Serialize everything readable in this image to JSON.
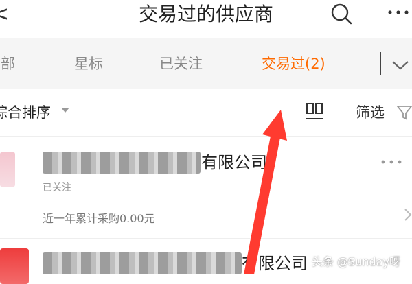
{
  "header": {
    "title": "交易过的供应商",
    "back_glyph": "<",
    "icons": {
      "back": "chevron-left-icon",
      "search": "search-icon",
      "more": "more-icon"
    }
  },
  "tabs": [
    {
      "label": "全部"
    },
    {
      "label": "星标"
    },
    {
      "label": "已关注"
    },
    {
      "label": "交易过(2)",
      "active": true
    }
  ],
  "toolbar": {
    "sort_label": "综合排序",
    "filter_label": "筛选"
  },
  "list": {
    "items": [
      {
        "name_suffix": "有限公司",
        "tag": "已关注",
        "stat": "近一年累计采购0.00元"
      },
      {
        "name_suffix": "有限公司"
      }
    ]
  },
  "watermark": "头条 @Sunday呀",
  "colors": {
    "accent": "#ff6a00",
    "arrow": "#ff3b30",
    "tab_bg": "#f5f5f5"
  }
}
